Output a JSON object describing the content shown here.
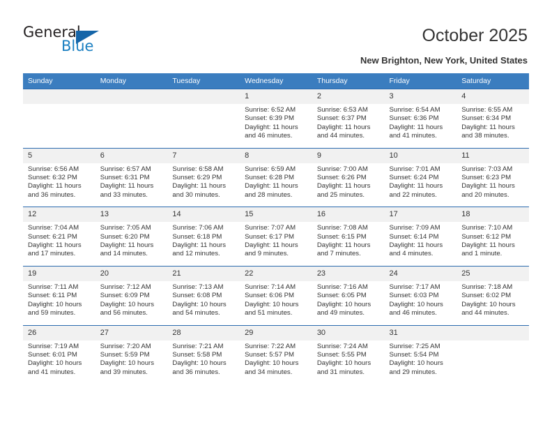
{
  "brand": {
    "name_part1": "General",
    "name_part2": "Blue",
    "logo_icon": "triangle-icon",
    "accent_color": "#1565a8",
    "blue_text_color": "#1a7fc1"
  },
  "header": {
    "title": "October 2025",
    "subtitle": "New Brighton, New York, United States"
  },
  "calendar": {
    "header_bg": "#3b7dbf",
    "daynum_bg": "#f1f1f1",
    "separator_color": "#2a6aae",
    "weekday_headers": [
      "Sunday",
      "Monday",
      "Tuesday",
      "Wednesday",
      "Thursday",
      "Friday",
      "Saturday"
    ],
    "weeks": [
      [
        {
          "day": "",
          "sunrise": "",
          "sunset": "",
          "daylight": ""
        },
        {
          "day": "",
          "sunrise": "",
          "sunset": "",
          "daylight": ""
        },
        {
          "day": "",
          "sunrise": "",
          "sunset": "",
          "daylight": ""
        },
        {
          "day": "1",
          "sunrise": "Sunrise: 6:52 AM",
          "sunset": "Sunset: 6:39 PM",
          "daylight": "Daylight: 11 hours and 46 minutes."
        },
        {
          "day": "2",
          "sunrise": "Sunrise: 6:53 AM",
          "sunset": "Sunset: 6:37 PM",
          "daylight": "Daylight: 11 hours and 44 minutes."
        },
        {
          "day": "3",
          "sunrise": "Sunrise: 6:54 AM",
          "sunset": "Sunset: 6:36 PM",
          "daylight": "Daylight: 11 hours and 41 minutes."
        },
        {
          "day": "4",
          "sunrise": "Sunrise: 6:55 AM",
          "sunset": "Sunset: 6:34 PM",
          "daylight": "Daylight: 11 hours and 38 minutes."
        }
      ],
      [
        {
          "day": "5",
          "sunrise": "Sunrise: 6:56 AM",
          "sunset": "Sunset: 6:32 PM",
          "daylight": "Daylight: 11 hours and 36 minutes."
        },
        {
          "day": "6",
          "sunrise": "Sunrise: 6:57 AM",
          "sunset": "Sunset: 6:31 PM",
          "daylight": "Daylight: 11 hours and 33 minutes."
        },
        {
          "day": "7",
          "sunrise": "Sunrise: 6:58 AM",
          "sunset": "Sunset: 6:29 PM",
          "daylight": "Daylight: 11 hours and 30 minutes."
        },
        {
          "day": "8",
          "sunrise": "Sunrise: 6:59 AM",
          "sunset": "Sunset: 6:28 PM",
          "daylight": "Daylight: 11 hours and 28 minutes."
        },
        {
          "day": "9",
          "sunrise": "Sunrise: 7:00 AM",
          "sunset": "Sunset: 6:26 PM",
          "daylight": "Daylight: 11 hours and 25 minutes."
        },
        {
          "day": "10",
          "sunrise": "Sunrise: 7:01 AM",
          "sunset": "Sunset: 6:24 PM",
          "daylight": "Daylight: 11 hours and 22 minutes."
        },
        {
          "day": "11",
          "sunrise": "Sunrise: 7:03 AM",
          "sunset": "Sunset: 6:23 PM",
          "daylight": "Daylight: 11 hours and 20 minutes."
        }
      ],
      [
        {
          "day": "12",
          "sunrise": "Sunrise: 7:04 AM",
          "sunset": "Sunset: 6:21 PM",
          "daylight": "Daylight: 11 hours and 17 minutes."
        },
        {
          "day": "13",
          "sunrise": "Sunrise: 7:05 AM",
          "sunset": "Sunset: 6:20 PM",
          "daylight": "Daylight: 11 hours and 14 minutes."
        },
        {
          "day": "14",
          "sunrise": "Sunrise: 7:06 AM",
          "sunset": "Sunset: 6:18 PM",
          "daylight": "Daylight: 11 hours and 12 minutes."
        },
        {
          "day": "15",
          "sunrise": "Sunrise: 7:07 AM",
          "sunset": "Sunset: 6:17 PM",
          "daylight": "Daylight: 11 hours and 9 minutes."
        },
        {
          "day": "16",
          "sunrise": "Sunrise: 7:08 AM",
          "sunset": "Sunset: 6:15 PM",
          "daylight": "Daylight: 11 hours and 7 minutes."
        },
        {
          "day": "17",
          "sunrise": "Sunrise: 7:09 AM",
          "sunset": "Sunset: 6:14 PM",
          "daylight": "Daylight: 11 hours and 4 minutes."
        },
        {
          "day": "18",
          "sunrise": "Sunrise: 7:10 AM",
          "sunset": "Sunset: 6:12 PM",
          "daylight": "Daylight: 11 hours and 1 minute."
        }
      ],
      [
        {
          "day": "19",
          "sunrise": "Sunrise: 7:11 AM",
          "sunset": "Sunset: 6:11 PM",
          "daylight": "Daylight: 10 hours and 59 minutes."
        },
        {
          "day": "20",
          "sunrise": "Sunrise: 7:12 AM",
          "sunset": "Sunset: 6:09 PM",
          "daylight": "Daylight: 10 hours and 56 minutes."
        },
        {
          "day": "21",
          "sunrise": "Sunrise: 7:13 AM",
          "sunset": "Sunset: 6:08 PM",
          "daylight": "Daylight: 10 hours and 54 minutes."
        },
        {
          "day": "22",
          "sunrise": "Sunrise: 7:14 AM",
          "sunset": "Sunset: 6:06 PM",
          "daylight": "Daylight: 10 hours and 51 minutes."
        },
        {
          "day": "23",
          "sunrise": "Sunrise: 7:16 AM",
          "sunset": "Sunset: 6:05 PM",
          "daylight": "Daylight: 10 hours and 49 minutes."
        },
        {
          "day": "24",
          "sunrise": "Sunrise: 7:17 AM",
          "sunset": "Sunset: 6:03 PM",
          "daylight": "Daylight: 10 hours and 46 minutes."
        },
        {
          "day": "25",
          "sunrise": "Sunrise: 7:18 AM",
          "sunset": "Sunset: 6:02 PM",
          "daylight": "Daylight: 10 hours and 44 minutes."
        }
      ],
      [
        {
          "day": "26",
          "sunrise": "Sunrise: 7:19 AM",
          "sunset": "Sunset: 6:01 PM",
          "daylight": "Daylight: 10 hours and 41 minutes."
        },
        {
          "day": "27",
          "sunrise": "Sunrise: 7:20 AM",
          "sunset": "Sunset: 5:59 PM",
          "daylight": "Daylight: 10 hours and 39 minutes."
        },
        {
          "day": "28",
          "sunrise": "Sunrise: 7:21 AM",
          "sunset": "Sunset: 5:58 PM",
          "daylight": "Daylight: 10 hours and 36 minutes."
        },
        {
          "day": "29",
          "sunrise": "Sunrise: 7:22 AM",
          "sunset": "Sunset: 5:57 PM",
          "daylight": "Daylight: 10 hours and 34 minutes."
        },
        {
          "day": "30",
          "sunrise": "Sunrise: 7:24 AM",
          "sunset": "Sunset: 5:55 PM",
          "daylight": "Daylight: 10 hours and 31 minutes."
        },
        {
          "day": "31",
          "sunrise": "Sunrise: 7:25 AM",
          "sunset": "Sunset: 5:54 PM",
          "daylight": "Daylight: 10 hours and 29 minutes."
        },
        {
          "day": "",
          "sunrise": "",
          "sunset": "",
          "daylight": ""
        }
      ]
    ]
  }
}
